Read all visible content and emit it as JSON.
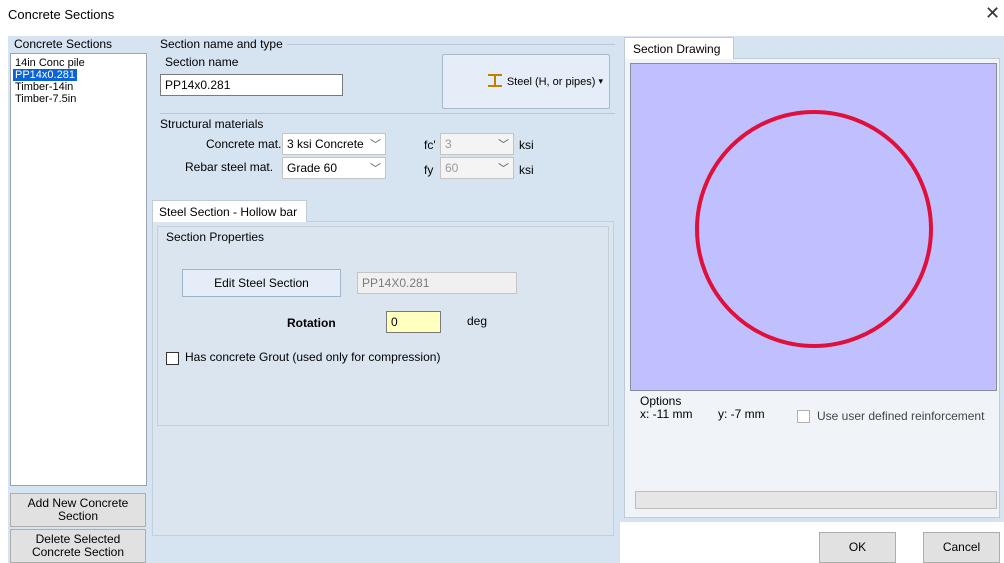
{
  "window": {
    "title": "Concrete Sections",
    "close_glyph": "✕"
  },
  "sections_panel": {
    "header": "Concrete Sections",
    "items": [
      {
        "label": "14in Conc pile",
        "selected": false
      },
      {
        "label": "PP14x0.281",
        "selected": true
      },
      {
        "label": "Timber-14in",
        "selected": false
      },
      {
        "label": "Timber-7.5in",
        "selected": false
      }
    ],
    "add_button": "Add New Concrete Section",
    "delete_button": "Delete Selected Concrete Section"
  },
  "name_type": {
    "group_label": "Section name and type",
    "name_label": "Section name",
    "name_value": "PP14x0.281",
    "type_button_label": "Steel (H, or pipes)",
    "type_icon": "i-beam-icon"
  },
  "materials": {
    "group_label": "Structural materials",
    "concrete_label": "Concrete mat.",
    "concrete_value": "3 ksi Concrete",
    "rebar_label": "Rebar steel mat.",
    "rebar_value": "Grade 60",
    "fc_label": "fc'",
    "fc_value": "3",
    "fc_unit": "ksi",
    "fy_label": "fy",
    "fy_value": "60",
    "fy_unit": "ksi"
  },
  "steel_tab": {
    "tab_label": "Steel Section - Hollow bar",
    "group_label": "Section Properties",
    "edit_button": "Edit Steel Section",
    "section_value": "PP14X0.281",
    "rotation_label": "Rotation",
    "rotation_value": "0",
    "rotation_unit": "deg",
    "grout_label": "Has concrete Grout (used only for compression)",
    "grout_checked": false
  },
  "drawing": {
    "tab_label": "Section Drawing",
    "canvas_color": "#c0c0ff",
    "circle_color": "#e0103c",
    "options_label": "Options",
    "x_readout": "x: -11 mm",
    "y_readout": "y: -7 mm",
    "reinforcement_label": "Use user defined reinforcement",
    "reinforcement_checked": false
  },
  "footer": {
    "ok": "OK",
    "cancel": "Cancel"
  }
}
